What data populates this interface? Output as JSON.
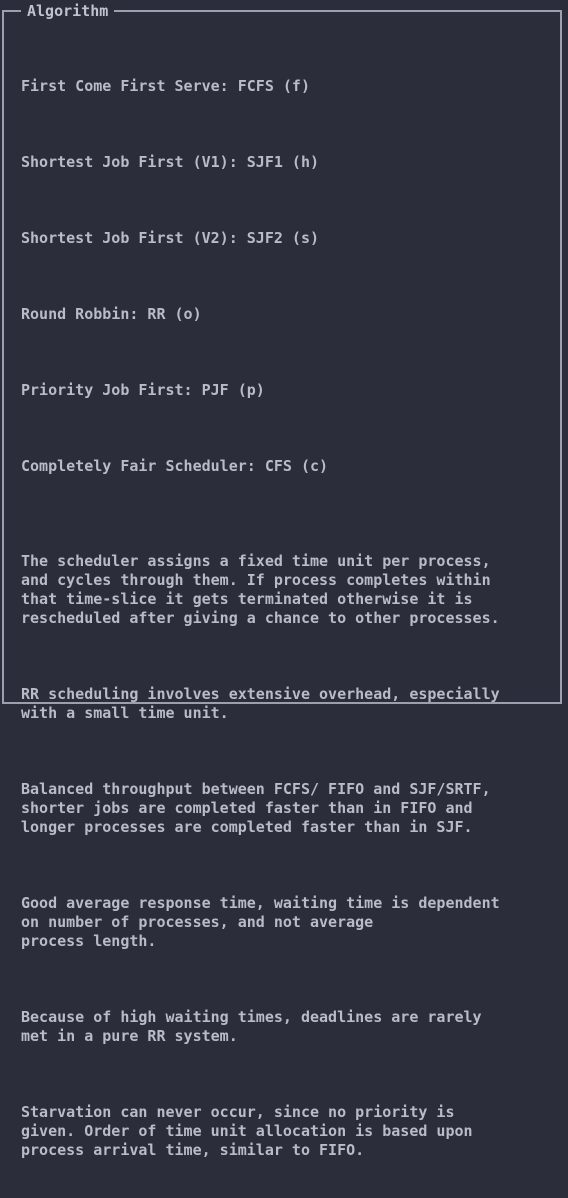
{
  "panel": {
    "title": "Algorithm"
  },
  "algorithms": [
    {
      "label": "First Come First Serve: FCFS (f)"
    },
    {
      "label": "Shortest Job First (V1): SJF1 (h)"
    },
    {
      "label": "Shortest Job First (V2): SJF2 (s)"
    },
    {
      "label": "Round Robbin: RR (o)"
    },
    {
      "label": "Priority Job First: PJF (p)"
    },
    {
      "label": "Completely Fair Scheduler: CFS (c)"
    }
  ],
  "description": [
    {
      "text": "The scheduler assigns a fixed time unit per process,\nand cycles through them. If process completes within\nthat time-slice it gets terminated otherwise it is\nrescheduled after giving a chance to other processes."
    },
    {
      "text": "RR scheduling involves extensive overhead, especially\nwith a small time unit."
    },
    {
      "text": "Balanced throughput between FCFS/ FIFO and SJF/SRTF,\nshorter jobs are completed faster than in FIFO and\nlonger processes are completed faster than in SJF."
    },
    {
      "text": "Good average response time, waiting time is dependent\non number of processes, and not average\nprocess length."
    },
    {
      "text": "Because of high waiting times, deadlines are rarely\nmet in a pure RR system."
    },
    {
      "text": "Starvation can never occur, since no priority is\ngiven. Order of time unit allocation is based upon\nprocess arrival time, similar to FIFO."
    }
  ],
  "colors": {
    "background": "#2b2d3a",
    "border": "#9aa0ad",
    "text": "#b9bcc6"
  }
}
